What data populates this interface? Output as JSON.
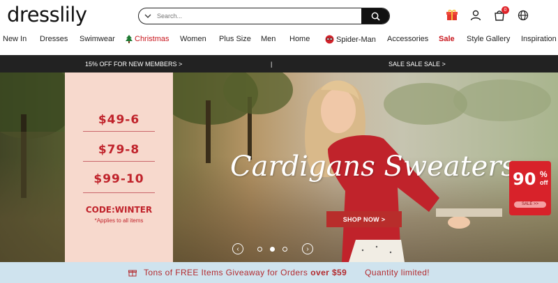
{
  "header": {
    "logo": "dresslily",
    "search_placeholder": "Search...",
    "bag_count": "0"
  },
  "nav": {
    "items": [
      "New In",
      "Dresses",
      "Swimwear",
      "Christmas",
      "Women",
      "Plus Size",
      "Men",
      "Home",
      "Spider-Man",
      "Accessories",
      "Sale",
      "Style Gallery",
      "Inspiration"
    ]
  },
  "promo": {
    "left": "15% OFF FOR NEW MEMBERS >",
    "divider": "|",
    "right": "SALE SALE SALE >"
  },
  "hero": {
    "prices": [
      "$49-6",
      "$79-8",
      "$99-10"
    ],
    "code": "CODE:WINTER",
    "code_note": "*Applies to all items",
    "headline": "Cardigans Sweaters",
    "cta": "SHOP NOW >",
    "badge_pct": "90",
    "badge_sign": "%",
    "badge_off": "off",
    "badge_sale": "SALE >>",
    "carousel_prev": "‹",
    "carousel_next": "›"
  },
  "bottom": {
    "text_a": "Tons of FREE Items Giveaway for Orders",
    "bold": "over $59",
    "text_b": "Quantity limited!"
  },
  "colors": {
    "accent_red": "#c0232b",
    "panel_pink": "#f7d9cd",
    "promo_bar": "#222222",
    "bottom_bar": "#cfe3ee"
  },
  "icons": [
    "chevron-down-icon",
    "search-icon",
    "gift-icon",
    "user-icon",
    "bag-icon",
    "globe-icon",
    "christmas-tree-icon",
    "spiderman-icon",
    "chevron-left-icon",
    "chevron-right-icon"
  ]
}
